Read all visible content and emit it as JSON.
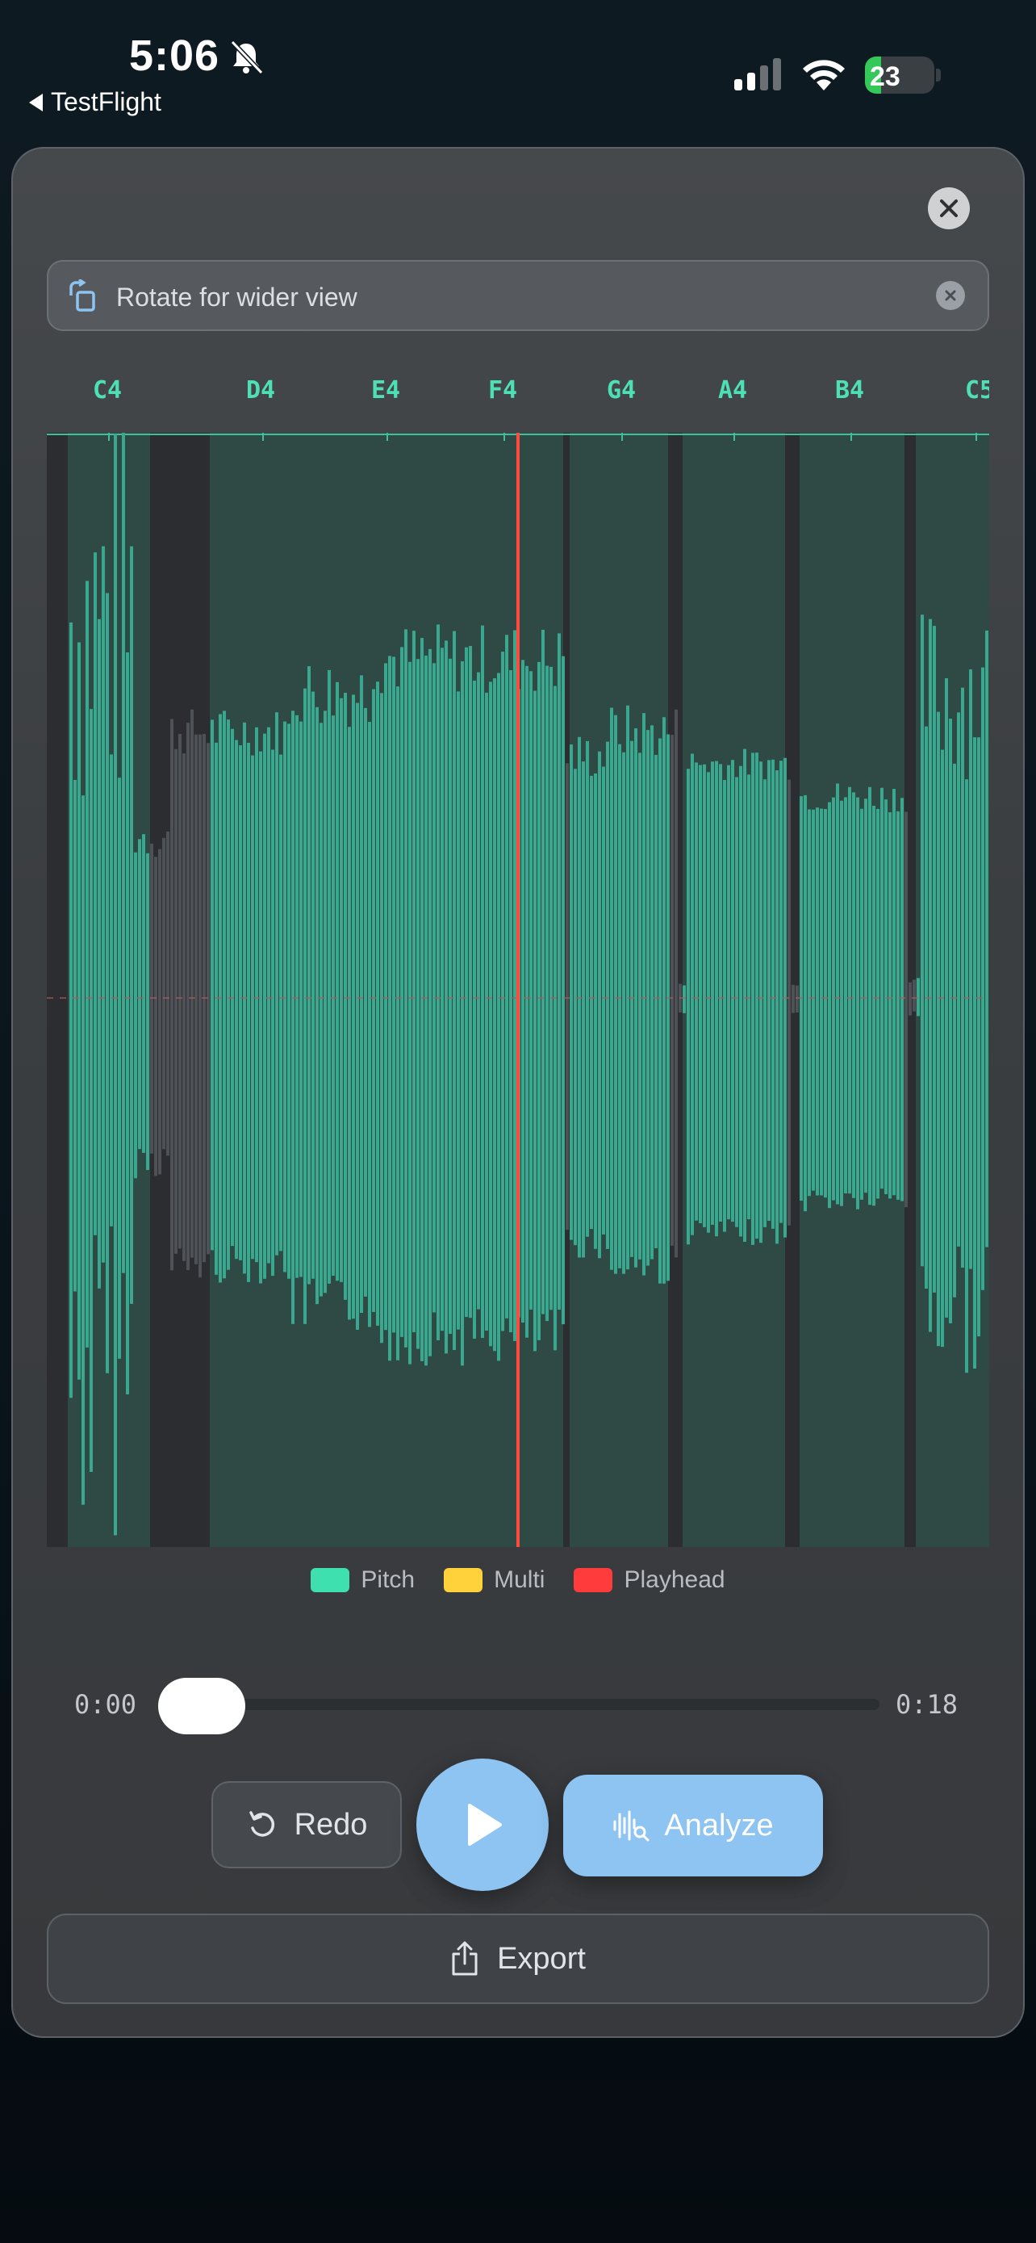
{
  "status": {
    "time": "5:06",
    "back_label": "TestFlight",
    "battery": "23",
    "battery_level": 0.23
  },
  "banner": {
    "label": "Rotate for wider view"
  },
  "notes": [
    "C4",
    "D4",
    "E4",
    "F4",
    "G4",
    "A4",
    "B4",
    "C5"
  ],
  "legend": [
    {
      "label": "Pitch",
      "color": "#3fe0b0"
    },
    {
      "label": "Multi",
      "color": "#ffd23c"
    },
    {
      "label": "Playhead",
      "color": "#ff3b3b"
    }
  ],
  "colors": {
    "waveform": "#3aa88e",
    "playhead": "#ff4a3d",
    "accent": "#8ec4f2"
  },
  "playback": {
    "current": "0:00",
    "duration": "0:18",
    "progress": 0.0
  },
  "buttons": {
    "redo": "Redo",
    "analyze": "Analyze",
    "export": "Export"
  },
  "icons": {
    "bell": "bell-slash-icon",
    "close": "close-icon",
    "rotate": "rotate-icon",
    "redo": "redo-icon",
    "play": "play-icon",
    "analyze": "waveform-search-icon",
    "export": "share-icon"
  }
}
